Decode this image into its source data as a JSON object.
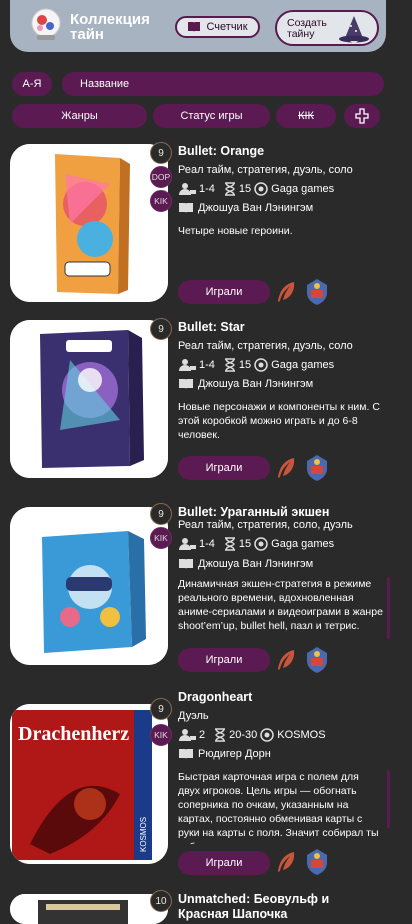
{
  "header": {
    "title": "Коллекция тайн",
    "counter_label": "Счетчик",
    "create_label": "Создать тайну"
  },
  "filters": {
    "sort_label": "А-Я",
    "search_placeholder": "Название",
    "genres_label": "Жанры",
    "status_label": "Статус игры",
    "kik_label": "КІК",
    "add_label": "+"
  },
  "games": [
    {
      "title": "Bullet: Orange",
      "count": "9",
      "tags": [
        "DOP",
        "KIK"
      ],
      "genres": "Реал тайм, стратегия, дуэль, соло",
      "players": "1-4",
      "time": "15",
      "publisher": "Gaga games",
      "author": "Джошуа Ван Лэнингэм",
      "description": "Четыре новые героини.",
      "played_label": "Играли"
    },
    {
      "title": "Bullet: Star",
      "count": "9",
      "tags": [],
      "genres": "Реал тайм, стратегия, дуэль, соло",
      "players": "1-4",
      "time": "15",
      "publisher": "Gaga games",
      "author": "Джошуа Ван Лэнингэм",
      "description": "Новые персонажи и компоненты к ним. С этой коробкой можно играть и до 6-8 человек.",
      "played_label": "Играли"
    },
    {
      "title": "Bullet: Ураганный экшен",
      "count": "9",
      "tags": [
        "KIK"
      ],
      "genres": "Реал тайм, стратегия, соло, дуэль",
      "players": "1-4",
      "time": "15",
      "publisher": "Gaga games",
      "author": "Джошуа Ван Лэнингэм",
      "description": "Динамичная экшен-стратегия в режиме реального времени, вдохновленная аниме-сериалами и видеоиграми в жанре shoot’em’up, bullet hell, пазл и тетрис.",
      "played_label": "Играли"
    },
    {
      "title": "Dragonheart",
      "count": "9",
      "tags": [
        "KIK"
      ],
      "genres": "Дуэль",
      "players": "2",
      "time": "20-30",
      "publisher": "KOSMOS",
      "author": "Рюдигер Дорн",
      "description": "Быстрая карточная игра с полем для двух игроков. Цель игры — обогнать соперника по очкам, указанным на картах, постоянно обменивая карты с руки на карты с поля. Значит собирал ты себе на поле очки.",
      "played_label": "Играли",
      "cover_text": "Drachenherz",
      "cover_brand": "KOSMOS"
    },
    {
      "title": "Unmatched: Беовульф и Красная Шапочка",
      "count": "10",
      "tags": []
    }
  ],
  "colors": {
    "accent": "#5c1a52",
    "header_bg": "#a7b3c0",
    "page_bg": "#2a2a2a"
  }
}
